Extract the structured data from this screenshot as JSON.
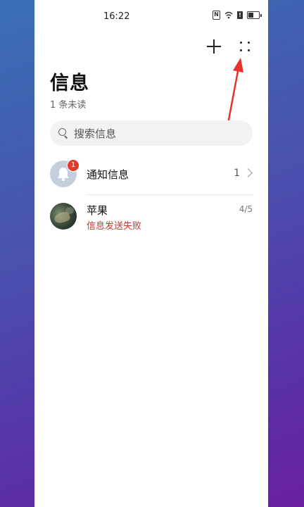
{
  "status_bar": {
    "time": "16:22",
    "nfc_label": "N",
    "alert_label": "!"
  },
  "header": {
    "title": "信息",
    "unread": "1 条未读"
  },
  "search": {
    "placeholder": "搜索信息"
  },
  "conversations": [
    {
      "name": "通知信息",
      "count": "1",
      "badge": "1",
      "avatar": "bell-icon"
    },
    {
      "name": "苹果",
      "status": "信息发送失败",
      "date": "4/5",
      "avatar": "photo"
    }
  ],
  "colors": {
    "badge": "#e33a2c",
    "annotation_arrow": "#e8332a",
    "fail_text": "#c0392b"
  }
}
